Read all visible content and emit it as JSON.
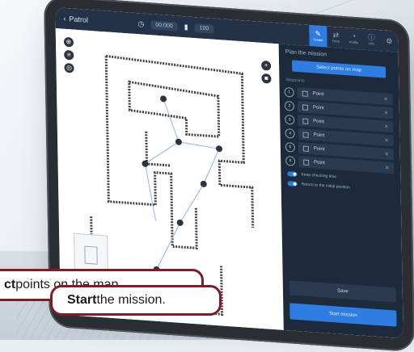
{
  "topbar": {
    "back_label": "Patrol",
    "pill_1": "00:000",
    "pill_2": "100",
    "tabs": [
      {
        "icon": "map-edit-icon",
        "label": "Create",
        "active": true
      },
      {
        "icon": "robot-icon",
        "label": "Drive"
      },
      {
        "icon": "user-icon",
        "label": "Profile"
      },
      {
        "icon": "info-icon",
        "label": "Info"
      },
      {
        "icon": "settings-icon",
        "label": ""
      }
    ]
  },
  "panel": {
    "title": "Plan the mission",
    "cta": "Select points on map",
    "subtitle": "Waypoints",
    "points": [
      {
        "num": "1",
        "label": "Point"
      },
      {
        "num": "2",
        "label": "Point"
      },
      {
        "num": "3",
        "label": "Point"
      },
      {
        "num": "4",
        "label": "Point"
      },
      {
        "num": "5",
        "label": "Point"
      },
      {
        "num": "6",
        "label": "Point"
      }
    ],
    "toggle_1": "Keep checking time",
    "toggle_2": "Return to the initial position",
    "save_label": "Save",
    "start_label": "Start mission"
  },
  "callouts": {
    "select_bold": "ct",
    "select_rest": " points on the map.",
    "start_bold": "Start",
    "start_rest": " the mission."
  },
  "colors": {
    "panel_bg": "#1d2a3c",
    "accent": "#2f7de1",
    "callout_border": "#7a1f28"
  }
}
